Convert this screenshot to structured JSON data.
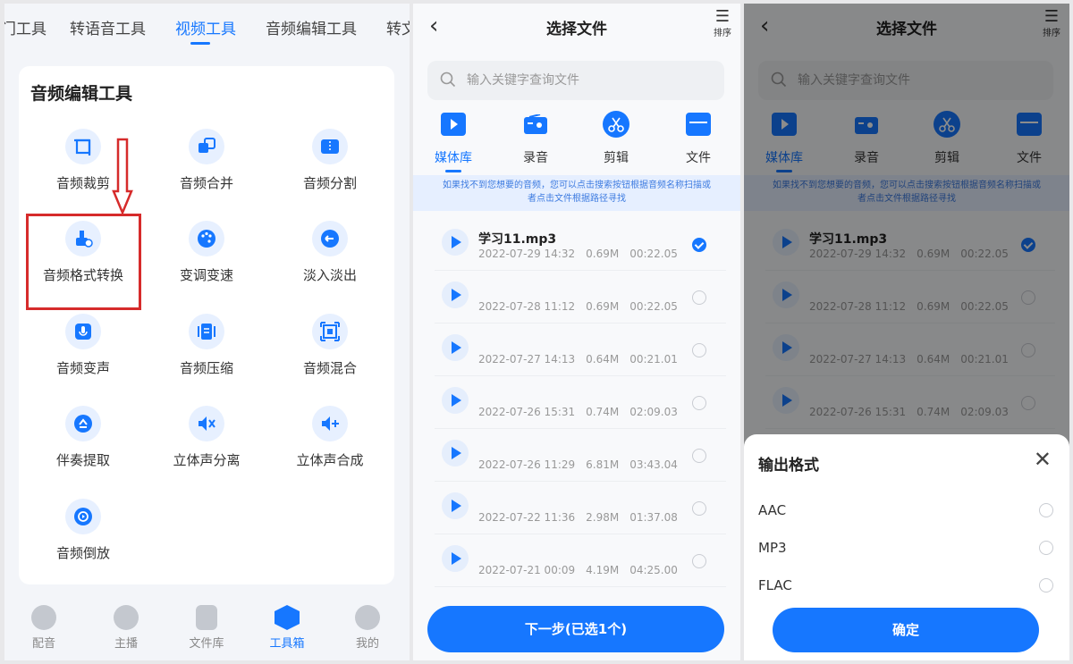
{
  "panel1": {
    "tabs": [
      "门工具",
      "转语音工具",
      "视频工具",
      "音频编辑工具",
      "转文"
    ],
    "active_tab": 2,
    "section_title": "音频编辑工具",
    "tools": [
      {
        "label": "音频裁剪",
        "icon": "crop-icon"
      },
      {
        "label": "音频合并",
        "icon": "merge-icon"
      },
      {
        "label": "音频分割",
        "icon": "split-icon"
      },
      {
        "label": "音频格式转换",
        "icon": "brush-convert-icon"
      },
      {
        "label": "变调变速",
        "icon": "palette-icon"
      },
      {
        "label": "淡入淡出",
        "icon": "fade-icon"
      },
      {
        "label": "音频变声",
        "icon": "microphone-icon"
      },
      {
        "label": "音频压缩",
        "icon": "compress-icon"
      },
      {
        "label": "音频混合",
        "icon": "mix-icon"
      },
      {
        "label": "伴奏提取",
        "icon": "extract-icon"
      },
      {
        "label": "立体声分离",
        "icon": "speaker-split-icon"
      },
      {
        "label": "立体声合成",
        "icon": "speaker-add-icon"
      },
      {
        "label": "音频倒放",
        "icon": "reverse-icon"
      }
    ],
    "bottom_nav": [
      {
        "label": "配音",
        "icon": "dub-icon"
      },
      {
        "label": "主播",
        "icon": "anchor-icon"
      },
      {
        "label": "文件库",
        "icon": "files-icon"
      },
      {
        "label": "工具箱",
        "icon": "toolbox-icon"
      },
      {
        "label": "我的",
        "icon": "profile-icon"
      }
    ],
    "active_nav": 3,
    "annotation_color": "#d62b2b"
  },
  "picker": {
    "title": "选择文件",
    "sort_label": "排序",
    "search_placeholder": "输入关键字查询文件",
    "categories": [
      {
        "label": "媒体库",
        "icon": "media-library-icon"
      },
      {
        "label": "录音",
        "icon": "radio-icon"
      },
      {
        "label": "剪辑",
        "icon": "scissors-icon"
      },
      {
        "label": "文件",
        "icon": "folder-icon"
      }
    ],
    "notice": "如果找不到您想要的音频，您可以点击搜索按钮根据音频名称扫描或者点击文件根据路径寻找",
    "files": [
      {
        "name": "学习11.mp3",
        "date": "2022-07-29 14:32",
        "size": "0.69M",
        "duration": "00:22.05",
        "selected": true
      },
      {
        "name": "",
        "date": "2022-07-28 11:12",
        "size": "0.69M",
        "duration": "00:22.05",
        "selected": false
      },
      {
        "name": "",
        "date": "2022-07-27 14:13",
        "size": "0.64M",
        "duration": "00:21.01",
        "selected": false
      },
      {
        "name": "",
        "date": "2022-07-26 15:31",
        "size": "0.74M",
        "duration": "02:09.03",
        "selected": false
      },
      {
        "name": "",
        "date": "2022-07-26 11:29",
        "size": "6.81M",
        "duration": "03:43.04",
        "selected": false
      },
      {
        "name": "",
        "date": "2022-07-22 11:36",
        "size": "2.98M",
        "duration": "01:37.08",
        "selected": false
      },
      {
        "name": "",
        "date": "2022-07-21 00:09",
        "size": "4.19M",
        "duration": "04:25.00",
        "selected": false
      }
    ],
    "next_button": "下一步(已选1个)",
    "accent": "#1677ff"
  },
  "sheet": {
    "title": "输出格式",
    "options": [
      "AAC",
      "MP3",
      "FLAC"
    ],
    "confirm": "确定"
  }
}
